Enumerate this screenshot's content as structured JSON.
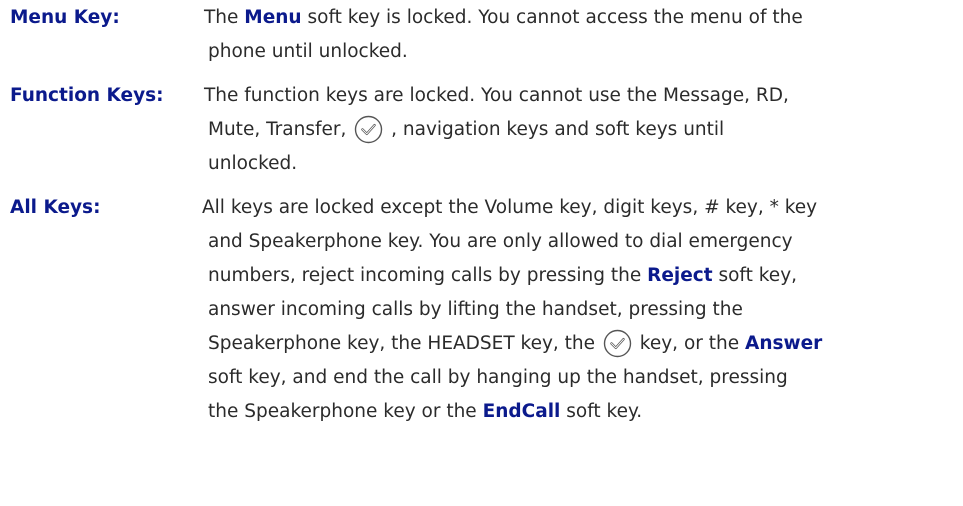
{
  "items": [
    {
      "term": "Menu Key:",
      "line1_a": "The ",
      "line1_b": "Menu",
      "line1_c": " soft key is locked. You cannot access the menu of the",
      "line2": "phone until unlocked."
    },
    {
      "term": "Function Keys:",
      "line1": "The function keys are locked. You cannot use the Message, RD,",
      "line2_a": "Mute, Transfer, ",
      "line2_b": " , navigation keys and soft keys until",
      "line3": "unlocked."
    },
    {
      "term": "All Keys:",
      "line1": "All keys are locked except the Volume key, digit keys, # key, * key",
      "line2": "and Speakerphone key. You are only allowed to dial emergency",
      "line3_a": "numbers, reject incoming calls by pressing the ",
      "line3_b": "Reject",
      "line3_c": " soft key,",
      "line4": "answer incoming calls by lifting the handset, pressing the",
      "line5_a": "Speakerphone key, the HEADSET key, the ",
      "line5_b": " key, or the ",
      "line5_c": "Answer",
      "line6": "soft key, and end the call by hanging up the handset, pressing",
      "line7_a": "the Speakerphone key or the ",
      "line7_b": "EndCall",
      "line7_c": " soft key."
    }
  ],
  "icons": {
    "ok": "ok-key-icon",
    "icon_color": "#555555",
    "term_color": "#0b1a8c",
    "text_color": "#2b2b2b"
  }
}
